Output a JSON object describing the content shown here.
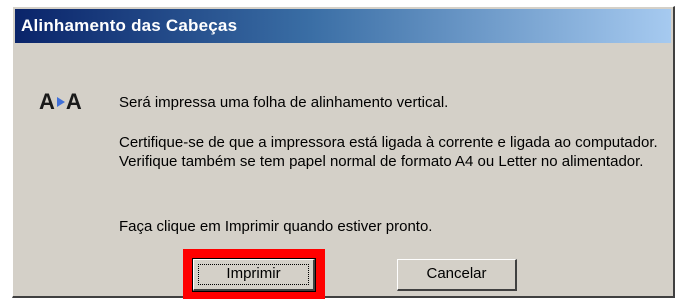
{
  "dialog": {
    "title": "Alinhamento das Cabeças",
    "icon": {
      "name": "alignment-icon",
      "glyph_left": "A",
      "glyph_right": "A"
    },
    "messages": [
      "Será impressa uma folha de alinhamento vertical.",
      "Certifique-se de que a impressora está ligada à corrente e ligada ao computador. Verifique também se tem papel normal de formato A4 ou Letter no alimentador.",
      "Faça clique em Imprimir quando estiver pronto."
    ],
    "buttons": {
      "print_label": "Imprimir",
      "cancel_label": "Cancelar"
    }
  },
  "colors": {
    "titlebar_start": "#0a246a",
    "titlebar_end": "#a6caf0",
    "dialog_face": "#d4d0c8",
    "highlight": "#ff0000",
    "icon_arrow": "#3f6fd8"
  }
}
